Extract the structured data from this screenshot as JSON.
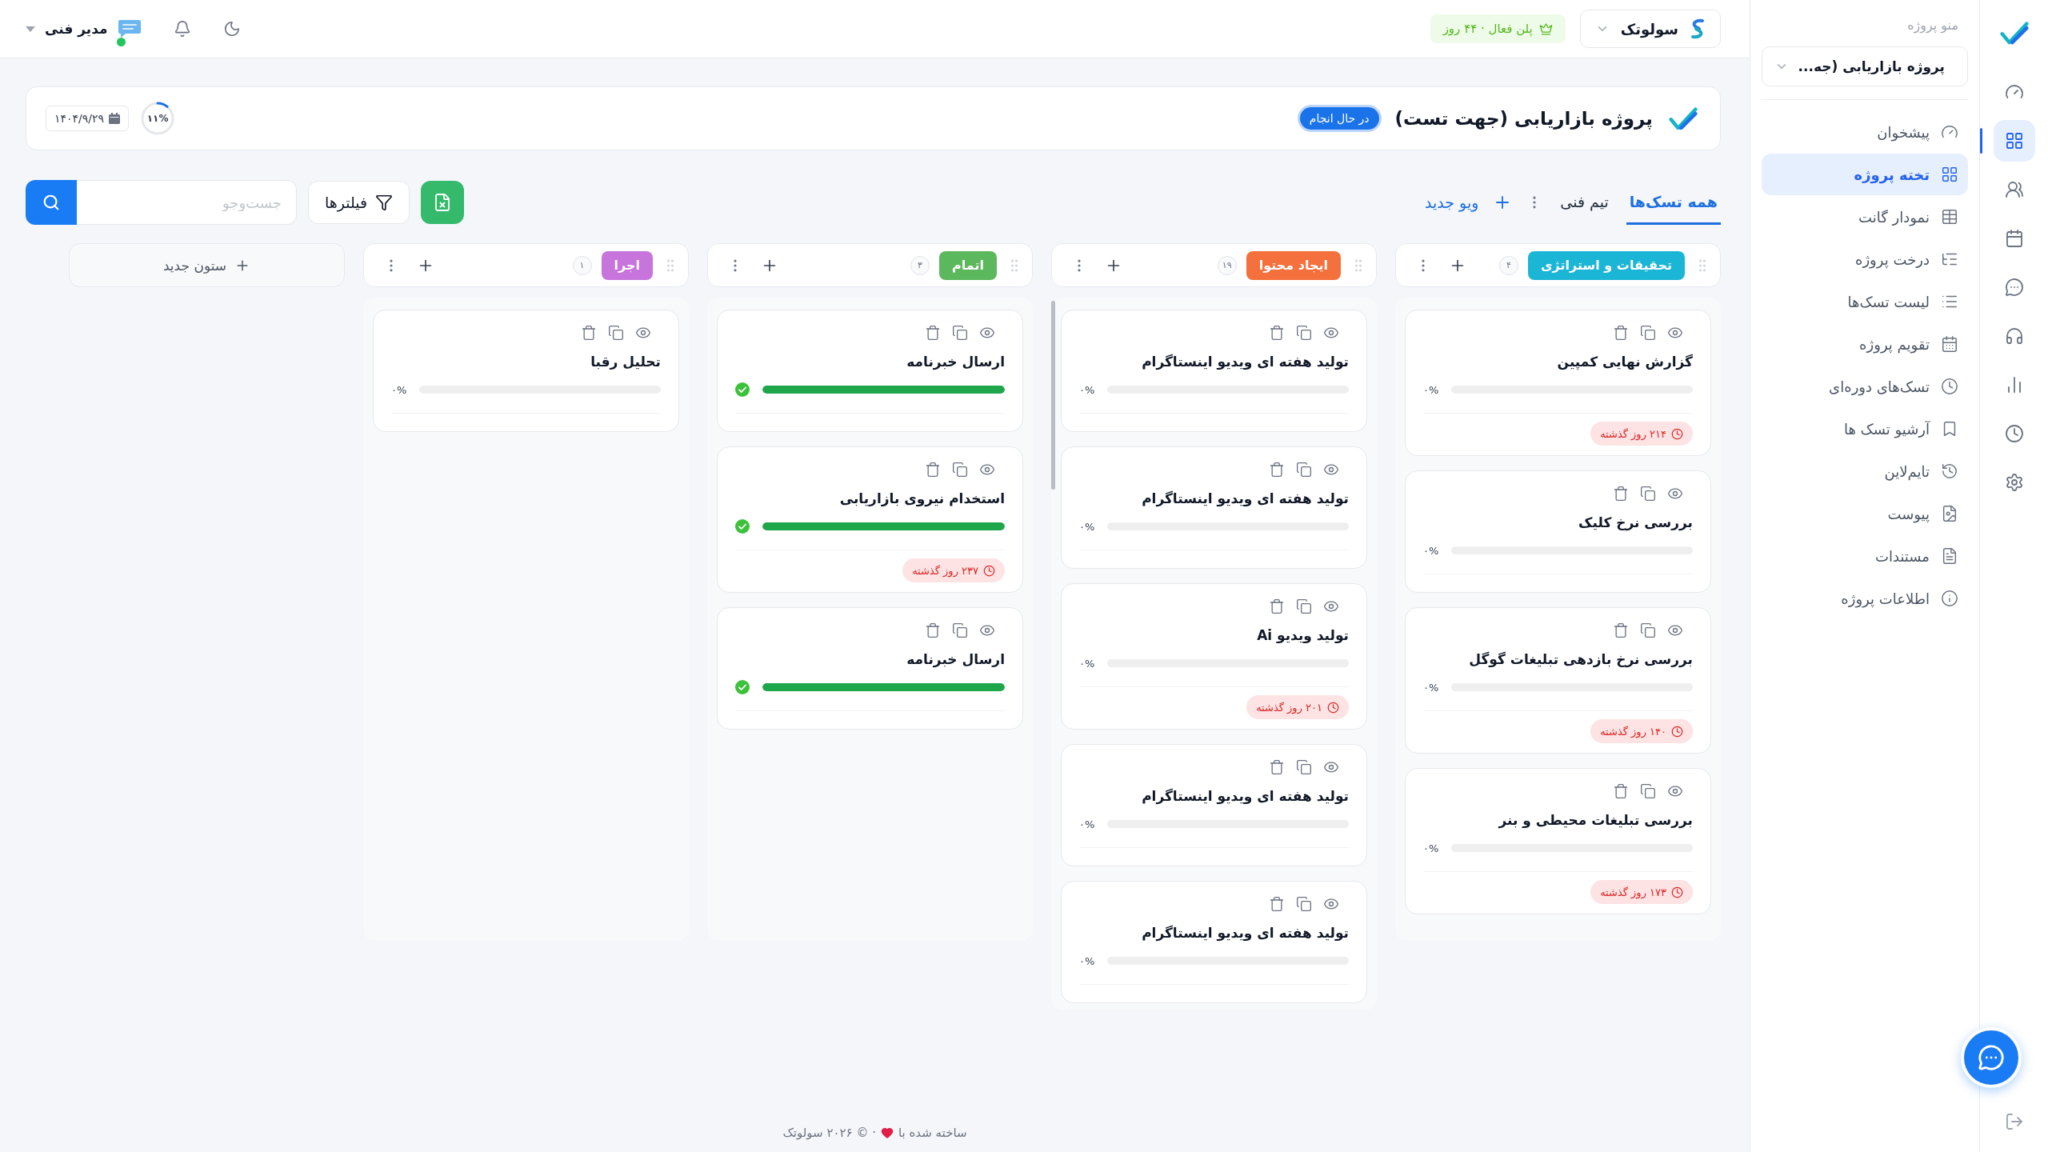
{
  "rail": {
    "items": [
      {
        "selected": false
      },
      {
        "selected": true
      },
      {
        "selected": false
      },
      {
        "selected": false
      },
      {
        "selected": false
      },
      {
        "selected": false
      },
      {
        "selected": false
      },
      {
        "selected": false
      },
      {
        "selected": false
      }
    ]
  },
  "sidebar": {
    "title": "منو پروژه",
    "project_select": {
      "value": "پروژه بازاریابی (جه..."
    },
    "items": [
      {
        "label": "پیشخوان",
        "selected": false
      },
      {
        "label": "تخته پروژه",
        "selected": true
      },
      {
        "label": "نمودار گانت",
        "selected": false
      },
      {
        "label": "درخت پروژه",
        "selected": false
      },
      {
        "label": "لیست تسک‌ها",
        "selected": false
      },
      {
        "label": "تقویم پروژه",
        "selected": false
      },
      {
        "label": "تسک‌های دوره‌ای",
        "selected": false
      },
      {
        "label": "آرشیو تسک ها",
        "selected": false
      },
      {
        "label": "تایم‌لاین",
        "selected": false
      },
      {
        "label": "پیوست",
        "selected": false
      },
      {
        "label": "مستندات",
        "selected": false
      },
      {
        "label": "اطلاعات پروژه",
        "selected": false
      }
    ]
  },
  "top_bar": {
    "workspace_select": {
      "value": "سولوتک"
    },
    "plan_badge": "پلن فعال · ۴۴ روز",
    "user": {
      "name": "مدیر فنی",
      "online": true
    }
  },
  "project": {
    "title": "پروژه بازاریابی (جهت تست)",
    "status": "در حال انجام",
    "progress": {
      "level": 0.11,
      "reading": "۱۱%"
    },
    "date": "۱۴۰۴/۹/۲۹"
  },
  "toolbar": {
    "tabs": [
      {
        "label": "همه تسک‌ها",
        "selected": true,
        "menu_button": false
      },
      {
        "label": "تیم فنی",
        "selected": false,
        "menu_button": true
      }
    ],
    "new_view_link": "ویو جدید",
    "filters_button": "فیلترها",
    "search": {
      "placeholder": "جست‌وجو"
    }
  },
  "columns": [
    {
      "title": "تحقیقات و استراتژی",
      "color": "#1bb5d6",
      "count": "۴",
      "scrollbar": false,
      "cards": [
        {
          "title": "گزارش نهایی کمپین",
          "level": 0,
          "completed": false,
          "progress_label": "۰%",
          "overdue": "۲۱۴ روز گذشته"
        },
        {
          "title": "بررسی نرخ کلیک",
          "level": 0,
          "completed": false,
          "progress_label": "۰%"
        },
        {
          "title": "بررسی نرخ بازدهی تبلیغات گوگل",
          "level": 0,
          "completed": false,
          "progress_label": "۰%",
          "overdue": "۱۴۰ روز گذشته"
        },
        {
          "title": "بررسی تبلیغات محیطی و بنر",
          "level": 0,
          "completed": false,
          "progress_label": "۰%",
          "overdue": "۱۷۳ روز گذشته"
        }
      ]
    },
    {
      "title": "ایجاد محتوا",
      "color": "#f4703c",
      "count": "۱۹",
      "scrollbar": true,
      "cards": [
        {
          "title": "تولید هفته ای ویدیو اینستاگرام",
          "level": 0,
          "completed": false,
          "progress_label": "۰%"
        },
        {
          "title": "تولید هفته ای ویدیو اینستاگرام",
          "level": 0,
          "completed": false,
          "progress_label": "۰%"
        },
        {
          "title": "تولید ویدیو Ai",
          "level": 0,
          "completed": false,
          "progress_label": "۰%",
          "overdue": "۲۰۱ روز گذشته"
        },
        {
          "title": "تولید هفته ای ویدیو اینستاگرام",
          "level": 0,
          "completed": false,
          "progress_label": "۰%"
        },
        {
          "title": "تولید هفته ای ویدیو اینستاگرام",
          "level": 0,
          "completed": false,
          "progress_label": "۰%"
        }
      ]
    },
    {
      "title": "اتمام",
      "color": "#5cb85c",
      "count": "۳",
      "scrollbar": false,
      "cards": [
        {
          "title": "ارسال خبرنامه",
          "level": 1,
          "completed": true
        },
        {
          "title": "استخدام نیروی بازاریابی",
          "level": 1,
          "completed": true,
          "overdue": "۲۳۷ روز گذشته"
        },
        {
          "title": "ارسال خبرنامه",
          "level": 1,
          "completed": true
        }
      ]
    },
    {
      "title": "اجرا",
      "color": "#c774dc",
      "count": "۱",
      "scrollbar": false,
      "cards": [
        {
          "title": "تحلیل رقبا",
          "level": 0,
          "completed": false,
          "progress_label": "۰%"
        }
      ]
    }
  ],
  "new_column_button": "ستون جدید",
  "footer": {
    "made_with": "ساخته شده با",
    "copyright": "· © ۲۰۲۶ سولوتک"
  }
}
